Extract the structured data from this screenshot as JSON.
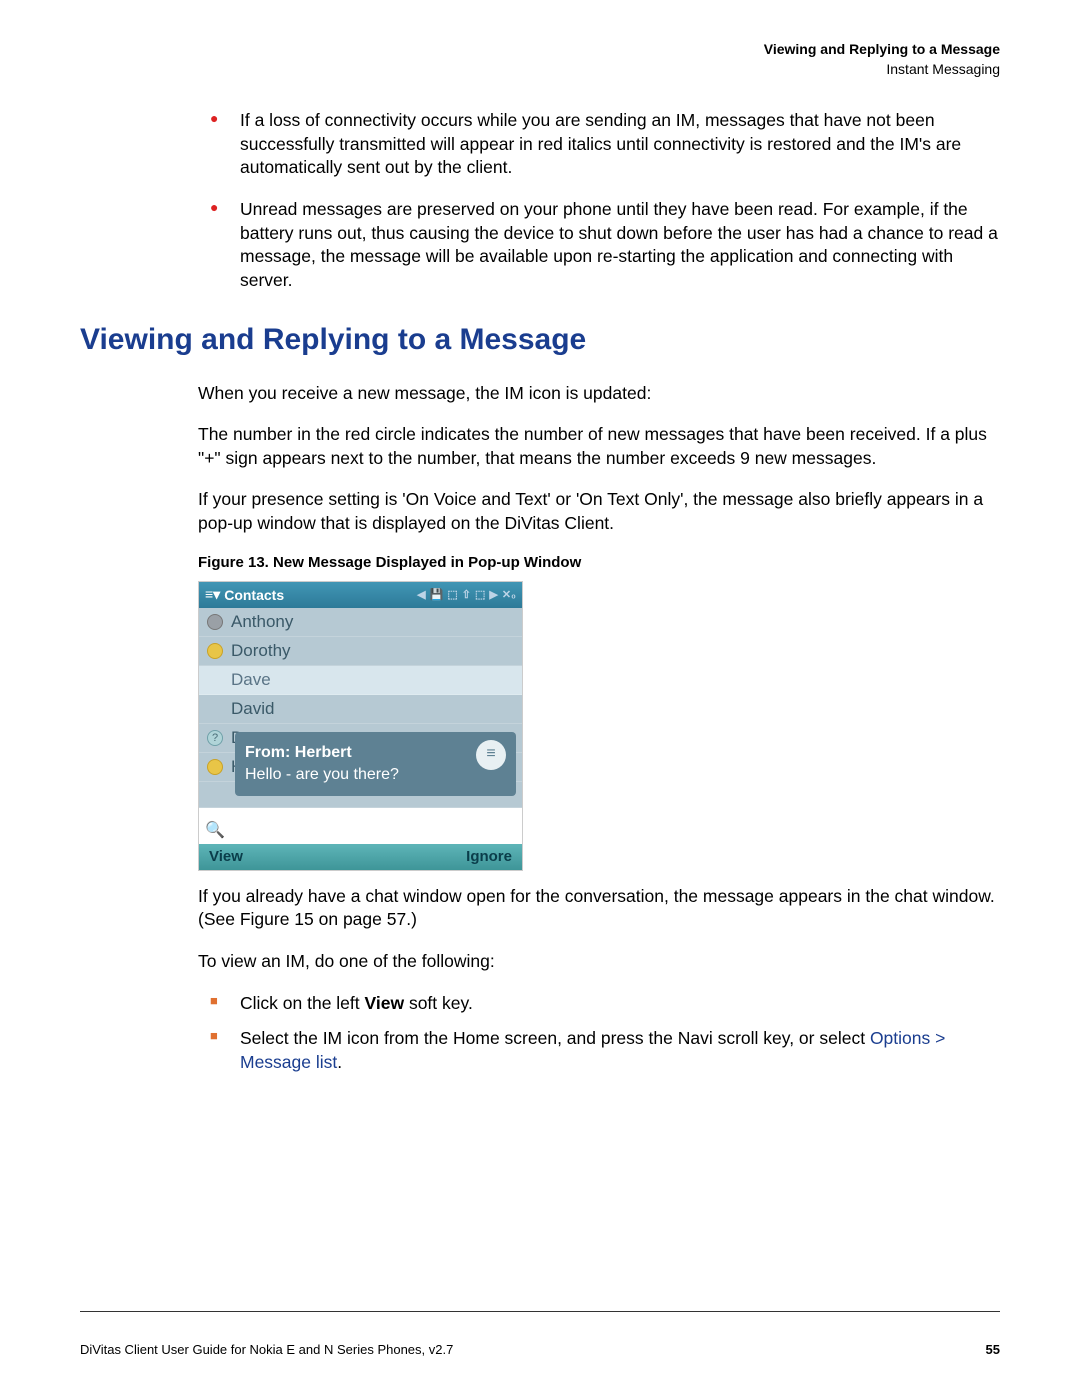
{
  "header": {
    "title": "Viewing and Replying to a Message",
    "subtitle": "Instant Messaging"
  },
  "bullets_top": [
    "If a loss of connectivity occurs while you are sending an IM, messages that have not been successfully transmitted will appear in red italics until connectivity is restored and the IM's are automatically sent out by the client.",
    "Unread messages are preserved on your phone until they have been read. For example, if the battery runs out, thus causing the device to shut down before the user has had a chance to read a message, the message will be available upon re-starting the application and connecting with server."
  ],
  "section_heading": "Viewing and Replying to a Message",
  "paragraphs": {
    "p1": "When you receive a new message, the IM icon is updated:",
    "p2": "The number in the red circle indicates the number of new messages that have been received. If a plus \"+\" sign appears next to the number, that means the number exceeds 9 new messages.",
    "p3": "If your presence setting is 'On Voice and Text' or 'On Text Only', the message also briefly appears in a pop-up window that is displayed on the DiVitas Client.",
    "p4": "If you already have a chat window open for the conversation, the message appears in the chat window. (See Figure 15 on page 57.)",
    "p5": "To view an IM, do one of the following:"
  },
  "figure_caption": "Figure 13.  New Message Displayed in Pop-up Window",
  "phone": {
    "topbar_title": "Contacts",
    "contacts": [
      {
        "name": "Anthony",
        "status": "gray"
      },
      {
        "name": "Dorothy",
        "status": "yellow"
      },
      {
        "name": "Dave",
        "status": "highlight"
      },
      {
        "name": "David",
        "status": "none"
      },
      {
        "name": "D",
        "status": "question"
      },
      {
        "name": "H",
        "status": "yellow"
      }
    ],
    "popup_from": "From: Herbert",
    "popup_body": "Hello - are you there?",
    "softkey_left": "View",
    "softkey_right": "Ignore"
  },
  "square_bullets": {
    "b1_prefix": "Click on the left ",
    "b1_bold": "View",
    "b1_suffix": " soft key.",
    "b2_prefix": "Select the IM icon from the Home screen, and press the Navi scroll key, or select ",
    "b2_link1": "Options",
    "b2_sep": " > ",
    "b2_link2": "Message list",
    "b2_suffix": "."
  },
  "footer": {
    "left": "DiVitas Client User Guide for Nokia E and N Series Phones, v2.7",
    "page": "55"
  }
}
